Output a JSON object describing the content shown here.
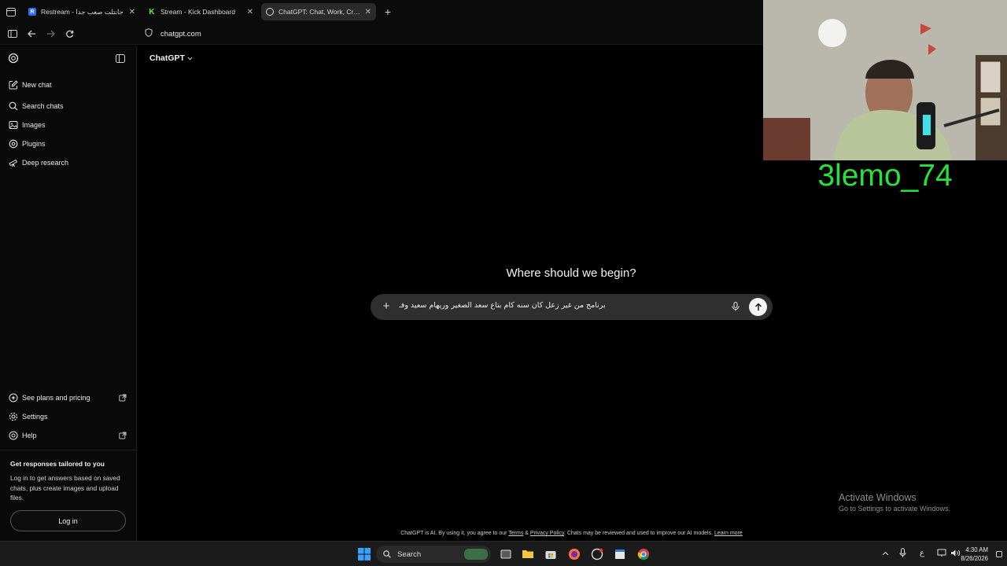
{
  "browser": {
    "tabs": [
      {
        "title": "جانتلت صعب جدا - Restream",
        "favicon": "R",
        "color": "#2f6bff",
        "active": false
      },
      {
        "title": "Stream - Kick Dashboard",
        "favicon": "K",
        "color": "#53fc18",
        "active": false
      },
      {
        "title": "ChatGPT: Chat, Work, Create &",
        "favicon": "gpt",
        "color": "#ffffff",
        "active": true
      }
    ],
    "url": "chatgpt.com"
  },
  "sidebar": {
    "items": [
      {
        "label": "New chat",
        "icon": "edit-icon"
      },
      {
        "label": "Search chats",
        "icon": "search-icon"
      },
      {
        "label": "Images",
        "icon": "image-icon"
      },
      {
        "label": "Plugins",
        "icon": "plugins-icon"
      },
      {
        "label": "Deep research",
        "icon": "telescope-icon"
      }
    ],
    "bottom_items": [
      {
        "label": "See plans and pricing",
        "icon": "sparkle-icon",
        "external": true
      },
      {
        "label": "Settings",
        "icon": "gear-icon",
        "external": false
      },
      {
        "label": "Help",
        "icon": "help-icon",
        "external": true
      }
    ],
    "promo": {
      "title": "Get responses tailored to you",
      "text": "Log in to get answers based on saved chats, plus create images and upload files.",
      "login_label": "Log in"
    }
  },
  "main": {
    "model": "ChatGPT",
    "headline": "Where should we begin?",
    "prompt_value": "برنامج من غير زعل كان سنه كام بتاع سعد الصغير وريهام سعيد وفـ",
    "footer": {
      "prefix": "ChatGPT is AI. By using it, you agree to our ",
      "terms": "Terms",
      "amp": " & ",
      "privacy": "Privacy Policy",
      "middle": ". Chats may be reviewed and used to improve our AI models. ",
      "learn": "Learn more"
    }
  },
  "overlay": {
    "streamer_name": "3lemo_74",
    "name_color": "#27e238"
  },
  "watermark": {
    "line1": "Activate Windows",
    "line2": "Go to Settings to activate Windows."
  },
  "taskbar": {
    "search_label": "Search",
    "lang": "ع",
    "time": "4:30 AM",
    "date": "8/26/2026"
  }
}
